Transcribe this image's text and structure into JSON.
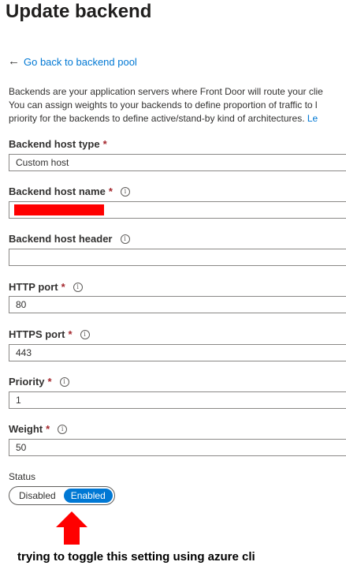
{
  "header": {
    "title": "Update backend"
  },
  "nav": {
    "back_label": "Go back to backend pool",
    "back_arrow": "←"
  },
  "description": {
    "line1": "Backends are your application servers where Front Door will route your clie",
    "line2": "You can assign weights to your backends to define proportion of traffic to l",
    "line3_text": "priority for the backends to define active/stand-by kind of architectures. ",
    "line3_link": "Le"
  },
  "fields": {
    "backend_host_type": {
      "label": "Backend host type",
      "value": "Custom host"
    },
    "backend_host_name": {
      "label": "Backend host name",
      "value": ""
    },
    "backend_host_header": {
      "label": "Backend host header",
      "value": ""
    },
    "http_port": {
      "label": "HTTP port",
      "value": "80"
    },
    "https_port": {
      "label": "HTTPS port",
      "value": "443"
    },
    "priority": {
      "label": "Priority",
      "value": "1"
    },
    "weight": {
      "label": "Weight",
      "value": "50"
    }
  },
  "common": {
    "required_mark": "*",
    "info_glyph": "i"
  },
  "status": {
    "label": "Status",
    "options": [
      "Disabled",
      "Enabled"
    ],
    "selected": "Enabled"
  },
  "annotation": {
    "caption": "trying to toggle this setting using azure cli",
    "arrow_color": "#ff0000"
  },
  "colors": {
    "accent": "#0078d4",
    "required": "#a4262c",
    "redaction": "#ff0000"
  }
}
